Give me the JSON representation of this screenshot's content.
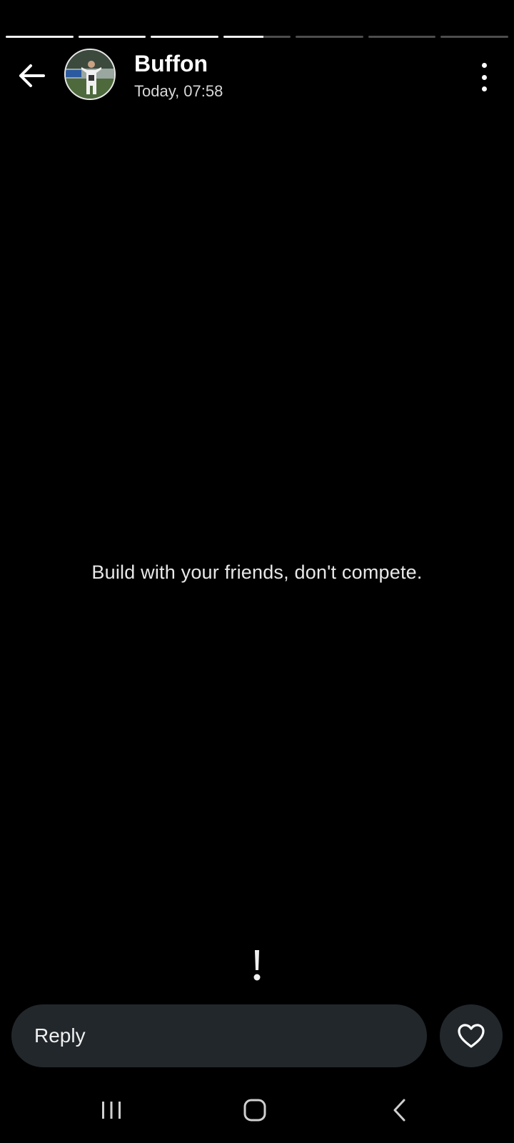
{
  "story": {
    "segments": [
      1,
      1,
      1,
      0.6,
      0,
      0,
      0
    ],
    "text": "Build with your friends, don't compete."
  },
  "header": {
    "user_name": "Buffon",
    "timestamp": "Today, 07:58",
    "back_icon": "arrow-left-icon",
    "avatar_alt": "Buffon avatar",
    "more_icon": "more-vertical-icon"
  },
  "reply": {
    "placeholder": "Reply"
  },
  "like": {
    "icon": "heart-icon"
  },
  "system_nav": {
    "recents_icon": "recents-icon",
    "home_icon": "home-icon",
    "back_icon": "chevron-left-icon"
  },
  "colors": {
    "background": "#000000",
    "input_bg": "#22272b",
    "progress_active": "#f2f2f2",
    "progress_inactive": "#4d4d4d"
  }
}
